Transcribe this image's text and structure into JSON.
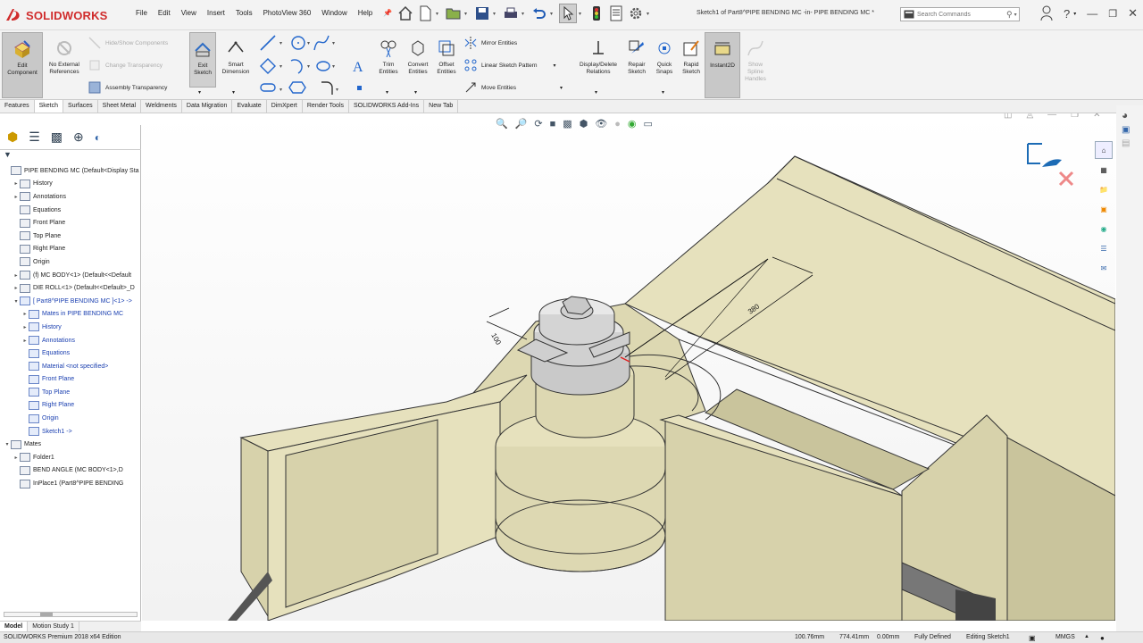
{
  "app": {
    "brand": "SOLIDWORKS",
    "title": "Sketch1 of Part8^PIPE BENDING MC -in- PIPE BENDING MC *"
  },
  "menus": [
    "File",
    "Edit",
    "View",
    "Insert",
    "Tools",
    "PhotoView 360",
    "Window",
    "Help"
  ],
  "search": {
    "placeholder": "Search Commands"
  },
  "ribbon": {
    "edit_component": "Edit Component",
    "no_external_refs": "No External References",
    "hide_show_components": "Hide/Show Components",
    "change_transparency": "Change Transparency",
    "assembly_transparency": "Assembly Transparency",
    "exit_sketch": "Exit Sketch",
    "smart_dimension": "Smart Dimension",
    "trim_entities": "Trim Entities",
    "convert_entities": "Convert Entities",
    "offset_entities": "Offset Entities",
    "mirror_entities": "Mirror Entities",
    "linear_sketch_pattern": "Linear Sketch Pattern",
    "move_entities": "Move Entities",
    "display_delete_relations": "Display/Delete Relations",
    "repair_sketch": "Repair Sketch",
    "quick_snaps": "Quick Snaps",
    "rapid_sketch": "Rapid Sketch",
    "instant2d": "Instant2D",
    "show_spline_handles": "Show Spline Handles"
  },
  "tabs": [
    "Features",
    "Sketch",
    "Surfaces",
    "Sheet Metal",
    "Weldments",
    "Data Migration",
    "Evaluate",
    "DimXpert",
    "Render Tools",
    "SOLIDWORKS Add-Ins",
    "New Tab"
  ],
  "active_tab": "Sketch",
  "tree": [
    {
      "label": "PIPE BENDING MC  (Default<Display Sta",
      "indent": 0,
      "arrow": "",
      "color": "normal"
    },
    {
      "label": "History",
      "indent": 1,
      "arrow": "▸",
      "color": "normal"
    },
    {
      "label": "Annotations",
      "indent": 1,
      "arrow": "▸",
      "color": "normal"
    },
    {
      "label": "Equations",
      "indent": 1,
      "arrow": "",
      "color": "normal"
    },
    {
      "label": "Front Plane",
      "indent": 1,
      "arrow": "",
      "color": "normal"
    },
    {
      "label": "Top Plane",
      "indent": 1,
      "arrow": "",
      "color": "normal"
    },
    {
      "label": "Right Plane",
      "indent": 1,
      "arrow": "",
      "color": "normal"
    },
    {
      "label": "Origin",
      "indent": 1,
      "arrow": "",
      "color": "normal"
    },
    {
      "label": "(f) MC BODY<1> (Default<<Default",
      "indent": 1,
      "arrow": "▸",
      "color": "normal"
    },
    {
      "label": "DIE ROLL<1> (Default<<Default>_D",
      "indent": 1,
      "arrow": "▸",
      "color": "normal"
    },
    {
      "label": "[ Part8^PIPE BENDING MC ]<1> ->",
      "indent": 1,
      "arrow": "▾",
      "color": "blue"
    },
    {
      "label": "Mates in PIPE BENDING MC",
      "indent": 2,
      "arrow": "▸",
      "color": "blue"
    },
    {
      "label": "History",
      "indent": 2,
      "arrow": "▸",
      "color": "blue"
    },
    {
      "label": "Annotations",
      "indent": 2,
      "arrow": "▸",
      "color": "blue"
    },
    {
      "label": "Equations",
      "indent": 2,
      "arrow": "",
      "color": "blue"
    },
    {
      "label": "Material <not specified>",
      "indent": 2,
      "arrow": "",
      "color": "blue"
    },
    {
      "label": "Front Plane",
      "indent": 2,
      "arrow": "",
      "color": "blue"
    },
    {
      "label": "Top Plane",
      "indent": 2,
      "arrow": "",
      "color": "blue"
    },
    {
      "label": "Right Plane",
      "indent": 2,
      "arrow": "",
      "color": "blue"
    },
    {
      "label": "Origin",
      "indent": 2,
      "arrow": "",
      "color": "blue"
    },
    {
      "label": "Sketch1 ->",
      "indent": 2,
      "arrow": "",
      "color": "blue"
    },
    {
      "label": "Mates",
      "indent": 0,
      "arrow": "▾",
      "color": "normal"
    },
    {
      "label": "Folder1",
      "indent": 1,
      "arrow": "▸",
      "color": "normal"
    },
    {
      "label": "BEND ANGLE (MC BODY<1>,D",
      "indent": 1,
      "arrow": "",
      "color": "normal"
    },
    {
      "label": "InPlace1 (Part8^PIPE BENDING",
      "indent": 1,
      "arrow": "",
      "color": "normal"
    }
  ],
  "bottom_tabs": [
    "Model",
    "Motion Study 1"
  ],
  "dimensions": {
    "d1": "100",
    "d2": "380"
  },
  "status": {
    "edition": "SOLIDWORKS Premium 2018 x64 Edition",
    "x": "100.76mm",
    "y": "774.41mm",
    "z": "0.00mm",
    "defined": "Fully Defined",
    "editing": "Editing Sketch1",
    "units": "MMGS"
  },
  "colors": {
    "model": "#e6e1bd",
    "model_dark": "#c9c49c",
    "brand_red": "#d02c2c",
    "tree_blue": "#1a3fb0"
  }
}
